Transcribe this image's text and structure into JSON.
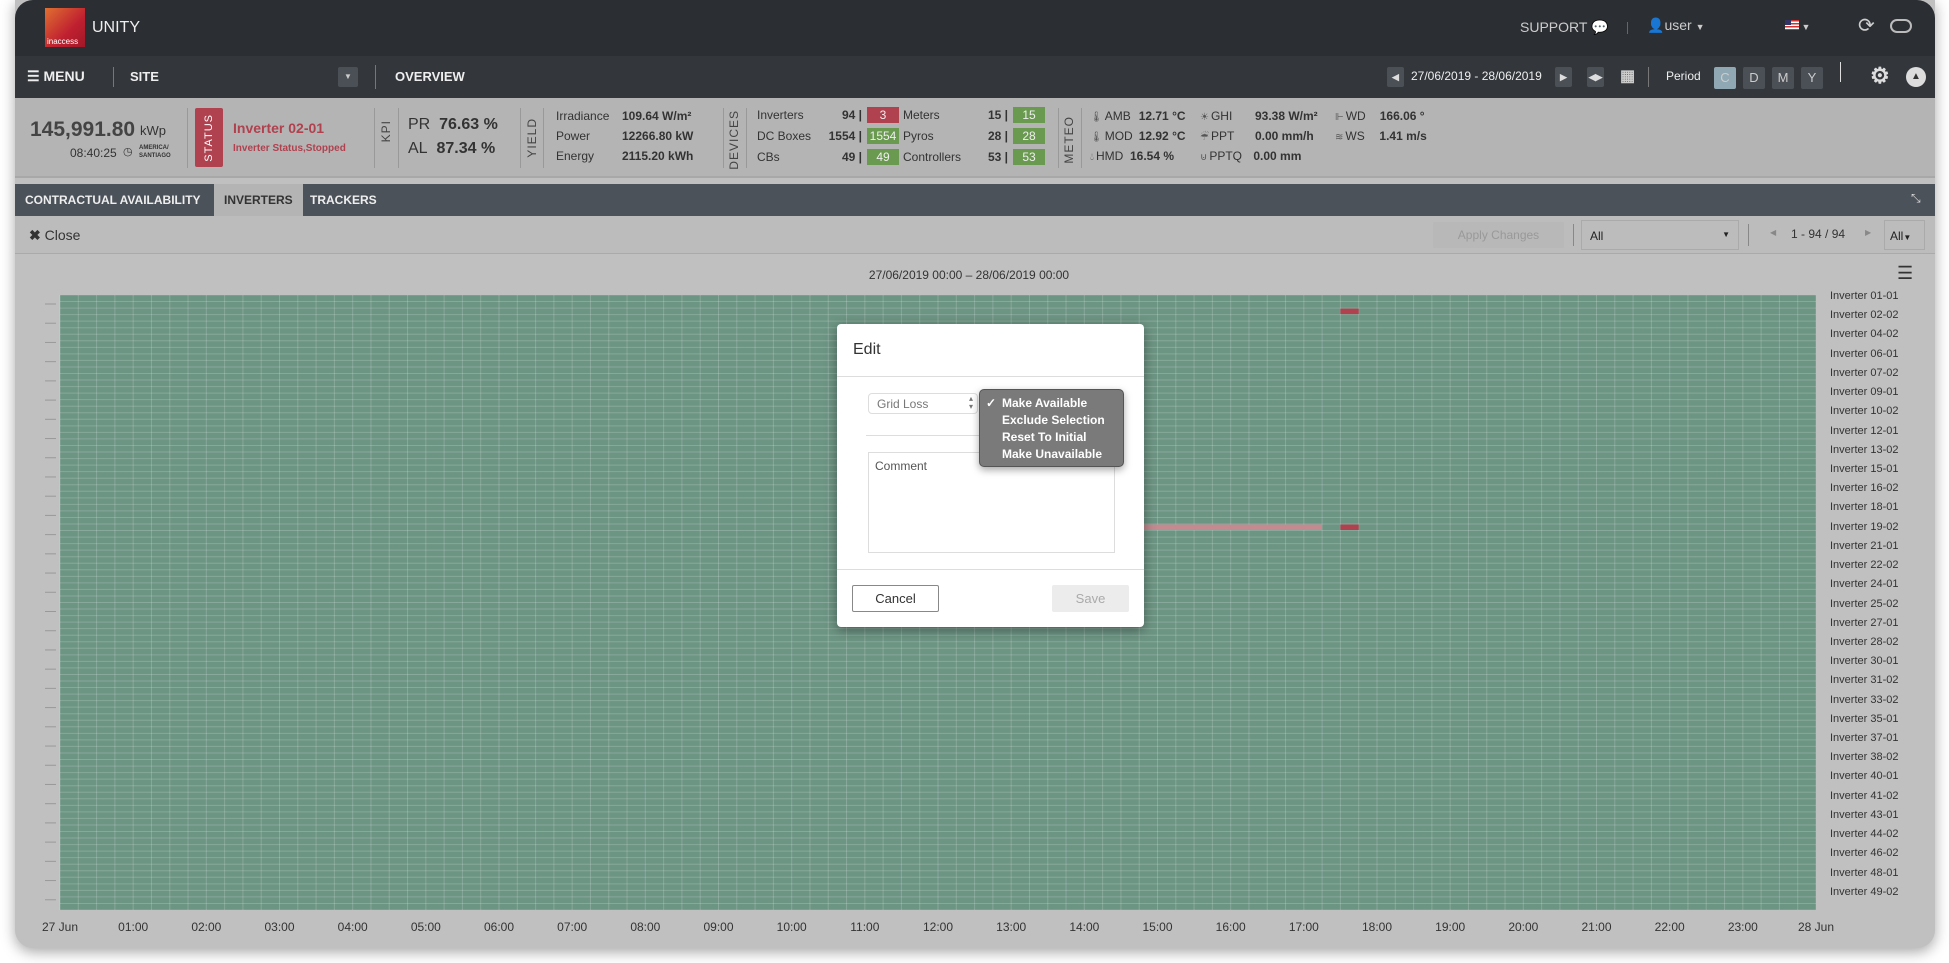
{
  "header": {
    "app_title": "UNITY",
    "logo_text": "inaccess",
    "support_label": "SUPPORT",
    "user_label": "user"
  },
  "nav": {
    "menu_label": "MENU",
    "site_label": "SITE",
    "overview_label": "OVERVIEW",
    "date_range": "27/06/2019 - 28/06/2019",
    "period_label": "Period",
    "periods": [
      "C",
      "D",
      "M",
      "Y"
    ],
    "active_period": "C"
  },
  "kpi": {
    "capacity": "145,991.80",
    "capacity_unit": "kWp",
    "time": "08:40:25",
    "timezone_line1": "AMERICA/",
    "timezone_line2": "SANTIAGO",
    "status_label": "STATUS",
    "status_device": "Inverter 02-01",
    "status_text": "Inverter Status,Stopped",
    "kpi_label": "KPI",
    "pr_label": "PR",
    "pr_value": "76.63 %",
    "al_label": "AL",
    "al_value": "87.34 %",
    "yield_label": "YIELD",
    "yield": [
      {
        "label": "Irradiance",
        "value": "109.64 W/m²"
      },
      {
        "label": "Power",
        "value": "12266.80 kW"
      },
      {
        "label": "Energy",
        "value": "2115.20 kWh"
      }
    ],
    "devices_label": "DEVICES",
    "devices_left": [
      {
        "label": "Inverters",
        "total": "94 |",
        "badge": "3",
        "color": "#b0414f"
      },
      {
        "label": "DC Boxes",
        "total": "1554 |",
        "badge": "1554",
        "color": "#6a9a50"
      },
      {
        "label": "CBs",
        "total": "49 |",
        "badge": "49",
        "color": "#6a9a50"
      }
    ],
    "devices_right": [
      {
        "label": "Meters",
        "total": "15 |",
        "badge": "15",
        "color": "#6a9a50"
      },
      {
        "label": "Pyros",
        "total": "28 |",
        "badge": "28",
        "color": "#6a9a50"
      },
      {
        "label": "Controllers",
        "total": "53 |",
        "badge": "53",
        "color": "#6a9a50"
      }
    ],
    "meteo_label": "METEO",
    "meteo": [
      {
        "label": "AMB",
        "value": "12.71 °C",
        "icon": "thermometer-icon"
      },
      {
        "label": "GHI",
        "value": "93.38 W/m²",
        "icon": "sun-icon"
      },
      {
        "label": "WD",
        "value": "166.06 °",
        "icon": "wind-direction-icon"
      },
      {
        "label": "MOD",
        "value": "12.92 °C",
        "icon": "thermometer-icon"
      },
      {
        "label": "PPT",
        "value": "0.00 mm/h",
        "icon": "rain-icon"
      },
      {
        "label": "WS",
        "value": "1.41 m/s",
        "icon": "wind-icon"
      },
      {
        "label": "HMD",
        "value": "16.54 %",
        "icon": "drop-icon"
      },
      {
        "label": "PPTQ",
        "value": "0.00 mm",
        "icon": "rain-gauge-icon"
      }
    ]
  },
  "tabs": [
    {
      "label": "CONTRACTUAL AVAILABILITY"
    },
    {
      "label": "INVERTERS",
      "active": true
    },
    {
      "label": "TRACKERS"
    }
  ],
  "toolbar": {
    "close_label": "Close",
    "apply_label": "Apply Changes",
    "filter_value": "All",
    "pagination": "1 - 94 / 94",
    "page_size": "All"
  },
  "chart_data": {
    "type": "heatmap",
    "title": "27/06/2019 00:00 – 28/06/2019 00:00",
    "row_count": 94,
    "slot_minutes": 15,
    "x_ticks": [
      "27 Jun",
      "01:00",
      "02:00",
      "03:00",
      "04:00",
      "05:00",
      "06:00",
      "07:00",
      "08:00",
      "09:00",
      "10:00",
      "11:00",
      "12:00",
      "13:00",
      "14:00",
      "15:00",
      "16:00",
      "17:00",
      "18:00",
      "19:00",
      "20:00",
      "21:00",
      "22:00",
      "23:00",
      "28 Jun"
    ],
    "y_labels": [
      "Inverter 01-01",
      "Inverter 02-02",
      "Inverter 04-02",
      "Inverter 06-01",
      "Inverter 07-02",
      "Inverter 09-01",
      "Inverter 10-02",
      "Inverter 12-01",
      "Inverter 13-02",
      "Inverter 15-01",
      "Inverter 16-02",
      "Inverter 18-01",
      "Inverter 19-02",
      "Inverter 21-01",
      "Inverter 22-02",
      "Inverter 24-01",
      "Inverter 25-02",
      "Inverter 27-01",
      "Inverter 28-02",
      "Inverter 30-01",
      "Inverter 31-02",
      "Inverter 33-02",
      "Inverter 35-01",
      "Inverter 37-01",
      "Inverter 38-02",
      "Inverter 40-01",
      "Inverter 41-02",
      "Inverter 43-01",
      "Inverter 44-02",
      "Inverter 46-02",
      "Inverter 48-01",
      "Inverter 49-02"
    ],
    "default_status": "available",
    "colors": {
      "available": "#6d9584",
      "unavailable": "#b0414f",
      "selected": "#c48a90"
    },
    "cells": [
      {
        "row": 2,
        "start": "17:30",
        "end": "17:45",
        "status": "unavailable"
      },
      {
        "row": 35,
        "start": "14:45",
        "end": "17:15",
        "status": "selected"
      },
      {
        "row": 35,
        "start": "17:30",
        "end": "17:45",
        "status": "unavailable"
      }
    ]
  },
  "modal": {
    "title": "Edit",
    "reason_value": "Grid Loss",
    "comment_placeholder": "Comment",
    "cancel_label": "Cancel",
    "save_label": "Save",
    "action_options": [
      {
        "label": "Make Available",
        "checked": true
      },
      {
        "label": "Exclude Selection"
      },
      {
        "label": "Reset To Initial"
      },
      {
        "label": "Make Unavailable"
      }
    ]
  }
}
